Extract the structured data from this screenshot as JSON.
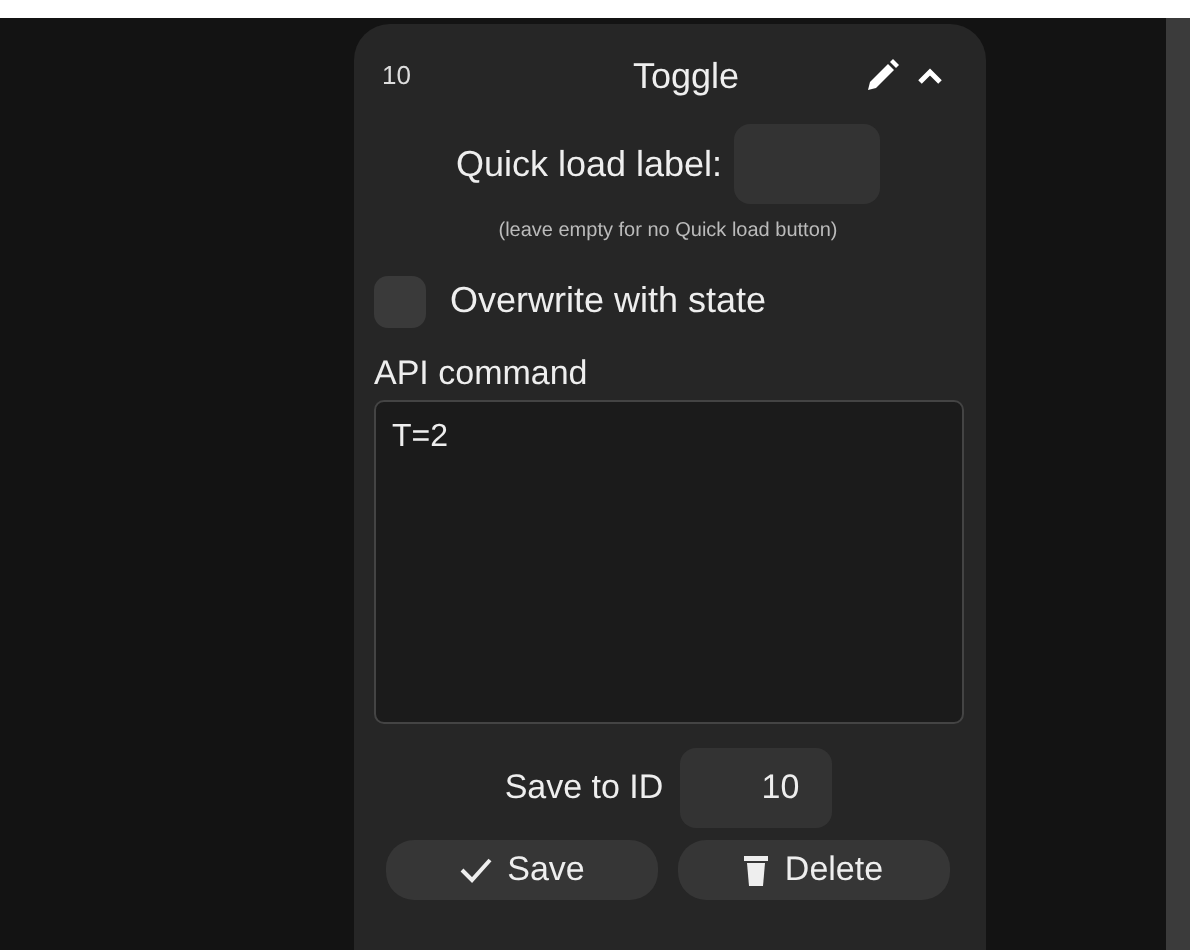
{
  "card": {
    "id": "10",
    "title": "Toggle"
  },
  "quick_load": {
    "label": "Quick load label:",
    "hint": "(leave empty for no Quick load button)"
  },
  "overwrite": {
    "label": "Overwrite with state",
    "checked": false
  },
  "api": {
    "label": "API command",
    "value": "T=2"
  },
  "save_to": {
    "label": "Save to ID",
    "value": "10"
  },
  "buttons": [
    {
      "kind": "save",
      "label": "Save"
    },
    {
      "kind": "delete",
      "label": "Delete"
    }
  ]
}
